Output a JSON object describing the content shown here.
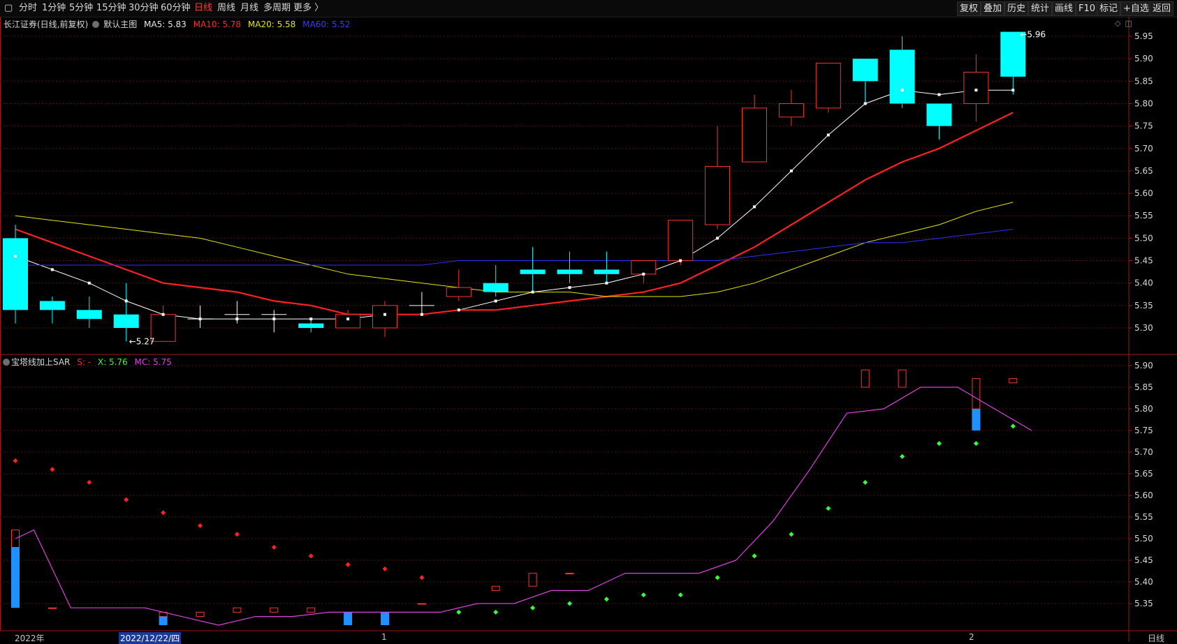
{
  "toolbar": {
    "back_icon": "square-icon",
    "periods": [
      "分时",
      "1分钟",
      "5分钟",
      "15分钟",
      "30分钟",
      "60分钟",
      "日线",
      "周线",
      "月线",
      "多周期",
      "更多 〉"
    ],
    "active_period": "日线",
    "right_buttons": [
      "复权",
      "叠加",
      "历史",
      "统计",
      "画线",
      "F10",
      "标记",
      "+自选",
      "返回"
    ]
  },
  "main_legend": {
    "title": "长江证券(日线,前复权)",
    "chart_name": "默认主图",
    "ma5": "MA5: 5.83",
    "ma10": "MA10: 5.78",
    "ma20": "MA20: 5.58",
    "ma60": "MA60: 5.52",
    "right_icons": [
      "diamond-icon",
      "window-icon"
    ]
  },
  "sub_legend": {
    "title": "宝塔线加上SAR",
    "s": "S: -",
    "x": "X: 5.76",
    "mc": "MC: 5.75"
  },
  "colors": {
    "up": "#ff3232",
    "down": "#00ffff",
    "ma5": "#ffffff",
    "ma10": "#ff2020",
    "ma20": "#e6e600",
    "ma60": "#2f2fff",
    "mc": "#e040e0",
    "sar_up": "#33ff33",
    "sar_down": "#ff2020",
    "tower_down": "#1e90ff"
  },
  "status_bar": {
    "left_label": "2022年",
    "cursor_date": "2022/12/22/四",
    "mark1": "1",
    "mark2": "2",
    "right_label": "日线"
  },
  "chart_data": [
    {
      "type": "candlestick",
      "title": "长江证券(日线,前复权)",
      "ylim": [
        5.25,
        5.97
      ],
      "y_ticks": [
        5.3,
        5.35,
        5.4,
        5.45,
        5.5,
        5.55,
        5.6,
        5.65,
        5.7,
        5.75,
        5.8,
        5.85,
        5.9,
        5.95
      ],
      "max_label": "5.96",
      "min_label": "5.27",
      "ohlc": [
        [
          5.5,
          5.53,
          5.31,
          5.34
        ],
        [
          5.36,
          5.37,
          5.31,
          5.34
        ],
        [
          5.34,
          5.37,
          5.3,
          5.32
        ],
        [
          5.33,
          5.4,
          5.27,
          5.3
        ],
        [
          5.27,
          5.35,
          5.27,
          5.33
        ],
        [
          5.32,
          5.35,
          5.3,
          5.32
        ],
        [
          5.33,
          5.36,
          5.31,
          5.33
        ],
        [
          5.33,
          5.34,
          5.29,
          5.33
        ],
        [
          5.31,
          5.32,
          5.29,
          5.3
        ],
        [
          5.3,
          5.34,
          5.3,
          5.33
        ],
        [
          5.3,
          5.36,
          5.28,
          5.35
        ],
        [
          5.35,
          5.38,
          5.33,
          5.35
        ],
        [
          5.37,
          5.43,
          5.36,
          5.39
        ],
        [
          5.4,
          5.44,
          5.37,
          5.38
        ],
        [
          5.43,
          5.48,
          5.38,
          5.42
        ],
        [
          5.43,
          5.47,
          5.4,
          5.42
        ],
        [
          5.43,
          5.47,
          5.4,
          5.42
        ],
        [
          5.42,
          5.45,
          5.4,
          5.45
        ],
        [
          5.45,
          5.54,
          5.44,
          5.54
        ],
        [
          5.53,
          5.75,
          5.52,
          5.66
        ],
        [
          5.67,
          5.82,
          5.67,
          5.79
        ],
        [
          5.77,
          5.83,
          5.75,
          5.8
        ],
        [
          5.79,
          5.89,
          5.78,
          5.89
        ],
        [
          5.9,
          5.9,
          5.8,
          5.85
        ],
        [
          5.92,
          5.95,
          5.79,
          5.8
        ],
        [
          5.8,
          5.8,
          5.72,
          5.75
        ],
        [
          5.8,
          5.91,
          5.76,
          5.87
        ],
        [
          5.96,
          5.96,
          5.82,
          5.86
        ]
      ],
      "series": [
        {
          "name": "MA5",
          "values": [
            5.46,
            5.43,
            5.4,
            5.36,
            5.33,
            5.32,
            5.32,
            5.32,
            5.32,
            5.32,
            5.33,
            5.33,
            5.34,
            5.36,
            5.38,
            5.39,
            5.4,
            5.42,
            5.45,
            5.5,
            5.57,
            5.65,
            5.73,
            5.8,
            5.83,
            5.82,
            5.83,
            5.83
          ]
        },
        {
          "name": "MA10",
          "values": [
            5.52,
            5.49,
            5.46,
            5.43,
            5.4,
            5.39,
            5.38,
            5.36,
            5.35,
            5.33,
            5.33,
            5.33,
            5.34,
            5.34,
            5.35,
            5.36,
            5.37,
            5.38,
            5.4,
            5.44,
            5.48,
            5.53,
            5.58,
            5.63,
            5.67,
            5.7,
            5.74,
            5.78
          ]
        },
        {
          "name": "MA20",
          "values": [
            5.55,
            5.54,
            5.53,
            5.52,
            5.51,
            5.5,
            5.48,
            5.46,
            5.44,
            5.42,
            5.41,
            5.4,
            5.39,
            5.38,
            5.38,
            5.38,
            5.37,
            5.37,
            5.37,
            5.38,
            5.4,
            5.43,
            5.46,
            5.49,
            5.51,
            5.53,
            5.56,
            5.58
          ]
        },
        {
          "name": "MA60",
          "values": [
            5.44,
            5.44,
            5.44,
            5.44,
            5.44,
            5.44,
            5.44,
            5.44,
            5.44,
            5.44,
            5.44,
            5.44,
            5.45,
            5.45,
            5.45,
            5.45,
            5.45,
            5.45,
            5.45,
            5.45,
            5.46,
            5.47,
            5.48,
            5.49,
            5.49,
            5.5,
            5.51,
            5.52
          ]
        }
      ]
    },
    {
      "type": "tower_sar",
      "title": "宝塔线加上SAR",
      "ylim": [
        5.29,
        5.92
      ],
      "y_ticks": [
        5.35,
        5.4,
        5.45,
        5.5,
        5.55,
        5.6,
        5.65,
        5.7,
        5.75,
        5.8,
        5.85,
        5.9
      ],
      "tower": [
        {
          "red": [
            5.48,
            5.52
          ],
          "blue": [
            5.34,
            5.48
          ]
        },
        {
          "red": [
            5.34,
            5.34
          ]
        },
        {},
        {},
        {
          "red": [
            5.32,
            5.33
          ],
          "blue": [
            5.3,
            5.32
          ]
        },
        {
          "red": [
            5.32,
            5.33
          ]
        },
        {
          "red": [
            5.33,
            5.34
          ]
        },
        {
          "red": [
            5.33,
            5.34
          ]
        },
        {
          "red": [
            5.33,
            5.34
          ]
        },
        {
          "blue": [
            5.3,
            5.33
          ]
        },
        {
          "blue": [
            5.3,
            5.33
          ]
        },
        {
          "red": [
            5.35,
            5.35
          ]
        },
        {},
        {
          "red": [
            5.38,
            5.39
          ]
        },
        {
          "red": [
            5.39,
            5.42
          ]
        },
        {
          "red": [
            5.42,
            5.42
          ]
        },
        {},
        {},
        {},
        {},
        {},
        {},
        {},
        {
          "red": [
            5.85,
            5.89
          ]
        },
        {
          "red": [
            5.85,
            5.89
          ]
        },
        {},
        {
          "red": [
            5.8,
            5.87
          ],
          "blue": [
            5.75,
            5.8
          ]
        },
        {
          "red": [
            5.86,
            5.87
          ]
        }
      ],
      "sar": [
        {
          "v": 5.68,
          "dir": "down"
        },
        {
          "v": 5.66,
          "dir": "down"
        },
        {
          "v": 5.63,
          "dir": "down"
        },
        {
          "v": 5.59,
          "dir": "down"
        },
        {
          "v": 5.56,
          "dir": "down"
        },
        {
          "v": 5.53,
          "dir": "down"
        },
        {
          "v": 5.51,
          "dir": "down"
        },
        {
          "v": 5.48,
          "dir": "down"
        },
        {
          "v": 5.46,
          "dir": "down"
        },
        {
          "v": 5.44,
          "dir": "down"
        },
        {
          "v": 5.43,
          "dir": "down"
        },
        {
          "v": 5.41,
          "dir": "down"
        },
        {
          "v": 5.33,
          "dir": "up"
        },
        {
          "v": 5.33,
          "dir": "up"
        },
        {
          "v": 5.34,
          "dir": "up"
        },
        {
          "v": 5.35,
          "dir": "up"
        },
        {
          "v": 5.36,
          "dir": "up"
        },
        {
          "v": 5.37,
          "dir": "up"
        },
        {
          "v": 5.37,
          "dir": "up"
        },
        {
          "v": 5.41,
          "dir": "up"
        },
        {
          "v": 5.46,
          "dir": "up"
        },
        {
          "v": 5.51,
          "dir": "up"
        },
        {
          "v": 5.57,
          "dir": "up"
        },
        {
          "v": 5.63,
          "dir": "up"
        },
        {
          "v": 5.69,
          "dir": "up"
        },
        {
          "v": 5.72,
          "dir": "up"
        },
        {
          "v": 5.72,
          "dir": "up"
        },
        {
          "v": 5.76,
          "dir": "up"
        }
      ],
      "series": [
        {
          "name": "MC",
          "values": [
            5.5,
            5.52,
            5.34,
            5.34,
            5.34,
            5.32,
            5.3,
            5.32,
            5.32,
            5.33,
            5.33,
            5.33,
            5.33,
            5.35,
            5.35,
            5.38,
            5.38,
            5.42,
            5.42,
            5.42,
            5.45,
            5.54,
            5.66,
            5.79,
            5.8,
            5.85,
            5.85,
            5.8,
            5.75
          ]
        }
      ]
    }
  ]
}
